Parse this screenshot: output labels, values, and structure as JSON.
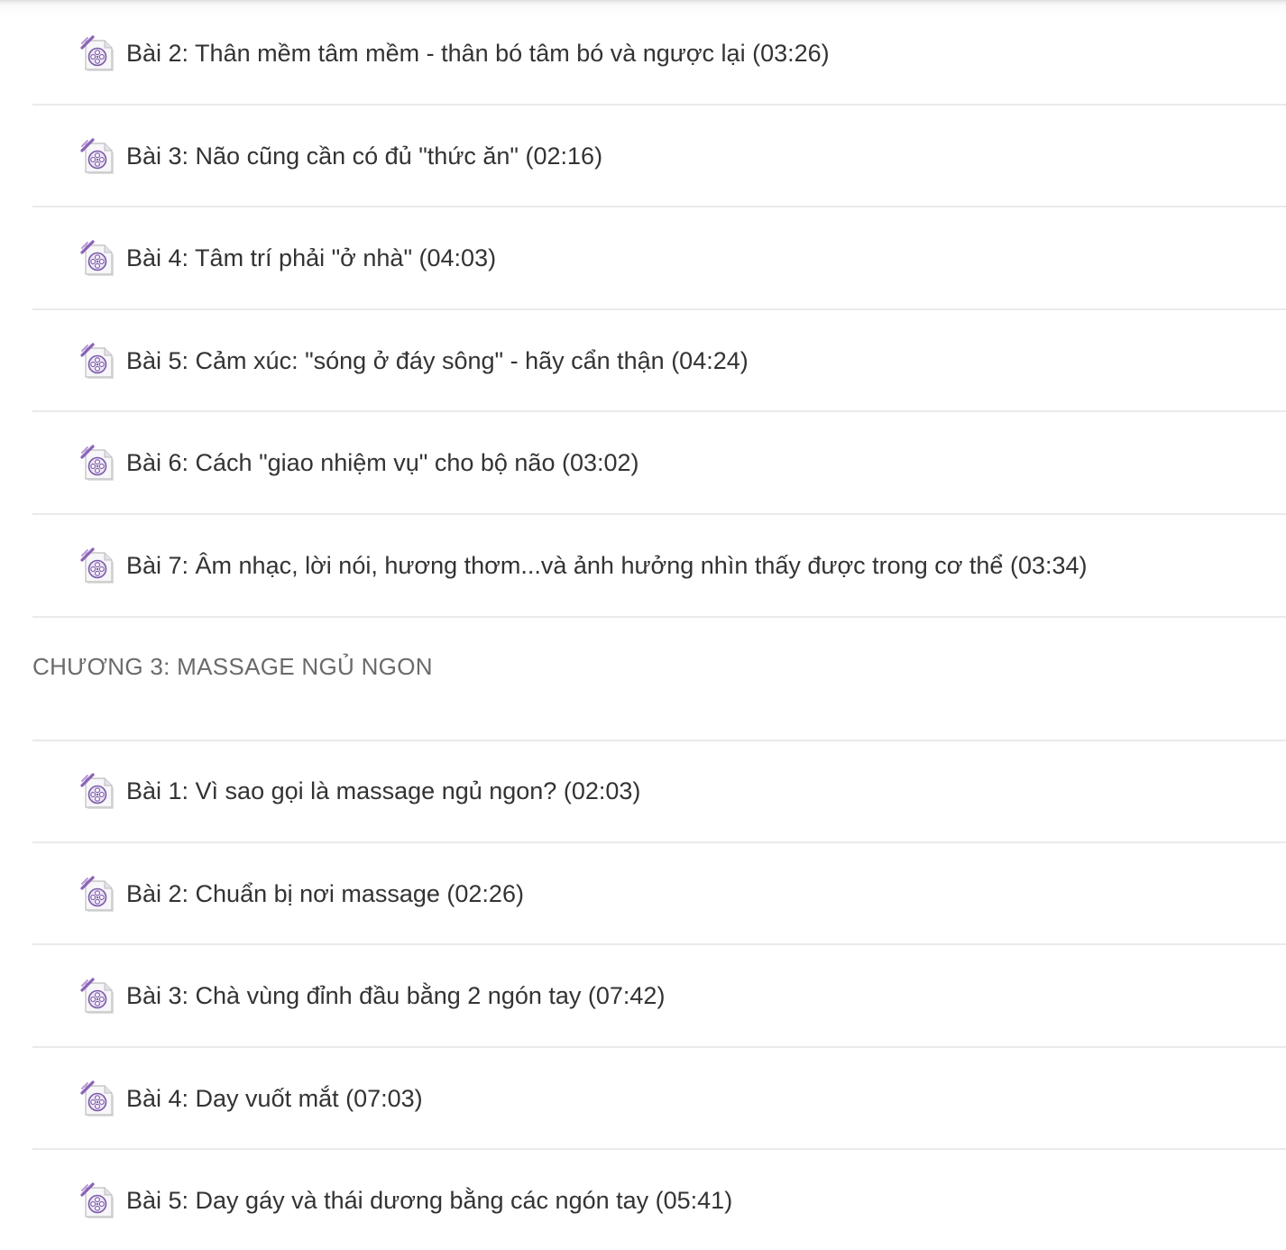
{
  "lessons_before": [
    {
      "title": "Bài 2: Thân mềm tâm mềm - thân bó tâm bó và ngược lại (03:26)",
      "icon": "video-file-icon"
    },
    {
      "title": "Bài 3: Não cũng cần có đủ \"thức ăn\" (02:16)",
      "icon": "video-file-icon"
    },
    {
      "title": "Bài 4: Tâm trí phải \"ở nhà\" (04:03)",
      "icon": "video-file-icon"
    },
    {
      "title": "Bài 5: Cảm xúc: \"sóng ở đáy sông\" - hãy cẩn thận (04:24)",
      "icon": "video-file-icon"
    },
    {
      "title": "Bài 6: Cách \"giao nhiệm vụ\" cho bộ não (03:02)",
      "icon": "video-file-icon"
    },
    {
      "title": "Bài 7: Âm nhạc, lời nói, hương thơm...và ảnh hưởng nhìn thấy được trong cơ thể (03:34)",
      "icon": "video-file-icon"
    }
  ],
  "chapter": {
    "title": "CHƯƠNG 3: MASSAGE NGỦ NGON"
  },
  "lessons_after": [
    {
      "title": "Bài 1: Vì sao gọi là massage ngủ ngon? (02:03)",
      "icon": "video-file-icon"
    },
    {
      "title": "Bài 2: Chuẩn bị nơi massage (02:26)",
      "icon": "video-file-icon"
    },
    {
      "title": "Bài 3: Chà vùng đỉnh đầu bằng 2 ngón tay (07:42)",
      "icon": "video-file-icon"
    },
    {
      "title": "Bài 4: Day vuốt mắt (07:03)",
      "icon": "video-file-icon"
    },
    {
      "title": "Bài 5: Day gáy và thái dương bằng các ngón tay (05:41)",
      "icon": "video-file-icon"
    }
  ],
  "colors": {
    "text": "#333333",
    "chapter_text": "#6a6a6a",
    "divider": "#eaeaea",
    "icon_accent": "#8a62b8"
  }
}
